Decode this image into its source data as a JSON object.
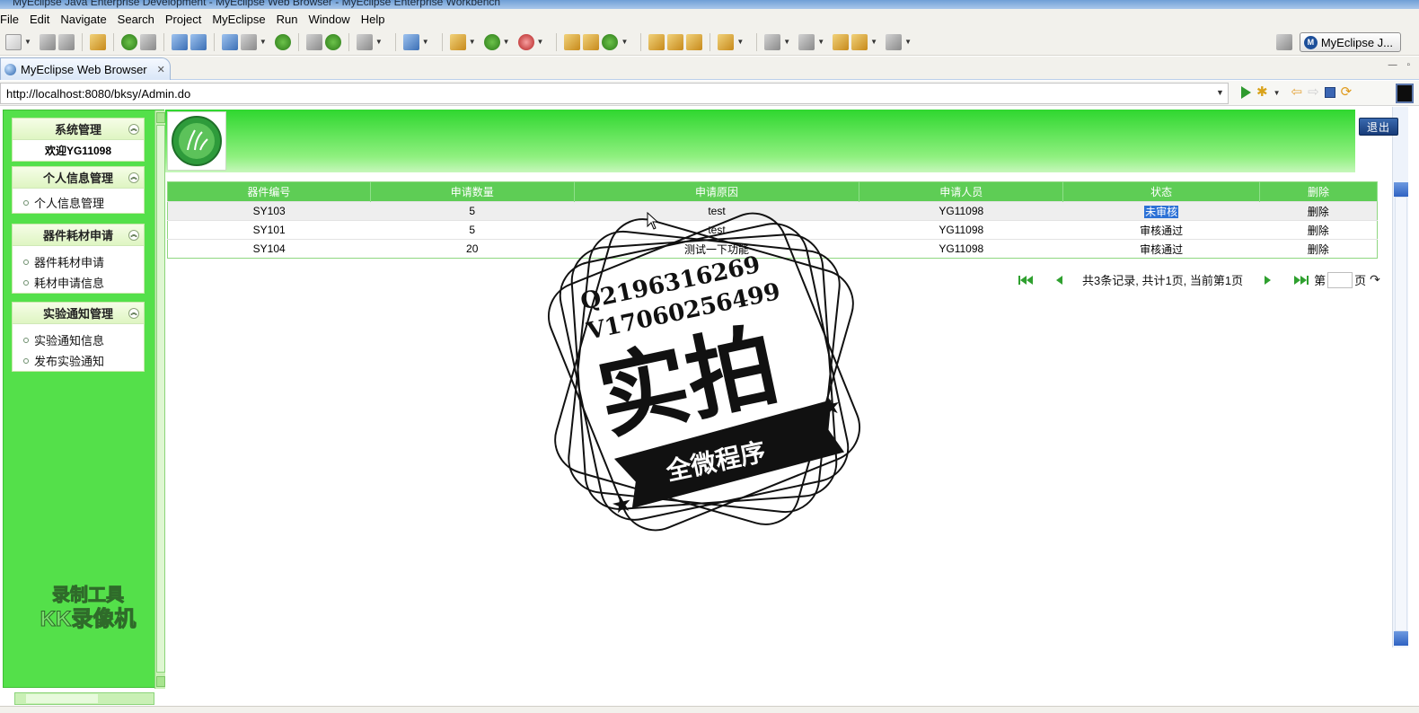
{
  "window": {
    "title": "MyEclipse Java Enterprise Development - MyEclipse Web Browser - MyEclipse Enterprise Workbench"
  },
  "menu": [
    "File",
    "Edit",
    "Navigate",
    "Search",
    "Project",
    "MyEclipse",
    "Run",
    "Window",
    "Help"
  ],
  "perspective": {
    "label": "MyEclipse J..."
  },
  "editor_tab": {
    "label": "MyEclipse Web Browser",
    "close": "✕"
  },
  "browser": {
    "url": "http://localhost:8080/bksy/Admin.do"
  },
  "sidebar": {
    "panels": [
      {
        "title": "系统管理",
        "welcome": "欢迎YG11098",
        "items": []
      },
      {
        "title": "个人信息管理",
        "items": [
          "个人信息管理"
        ]
      },
      {
        "title": "器件耗材申请",
        "items": [
          "器件耗材申请",
          "耗材申请信息"
        ]
      },
      {
        "title": "实验通知管理",
        "items": [
          "实验通知信息",
          "发布实验通知"
        ]
      }
    ],
    "watermark": {
      "line1": "录制工具",
      "line2": "KK录像机"
    }
  },
  "header": {
    "logout": "退出"
  },
  "table": {
    "columns": [
      "器件编号",
      "申请数量",
      "申请原因",
      "申请人员",
      "状态",
      "删除"
    ],
    "rows": [
      {
        "code": "SY103",
        "qty": "5",
        "reason": "test",
        "applicant": "YG11098",
        "status": "未审核",
        "delete": "删除"
      },
      {
        "code": "SY101",
        "qty": "5",
        "reason": "test",
        "applicant": "YG11098",
        "status": "审核通过",
        "delete": "删除"
      },
      {
        "code": "SY104",
        "qty": "20",
        "reason": "测试一下功能",
        "applicant": "YG11098",
        "status": "审核通过",
        "delete": "删除"
      }
    ]
  },
  "pager": {
    "summary": "共3条记录, 共计1页, 当前第1页",
    "page_prefix": "第",
    "page_suffix": "页"
  },
  "stamp": {
    "line1": "Q2196316269",
    "line2": "V17060256499",
    "big": "实拍",
    "ribbon": "全微程序"
  },
  "colors": {
    "accent_green": "#54e04a",
    "header_green": "#5ecd55",
    "selection_blue": "#2c71d6"
  }
}
